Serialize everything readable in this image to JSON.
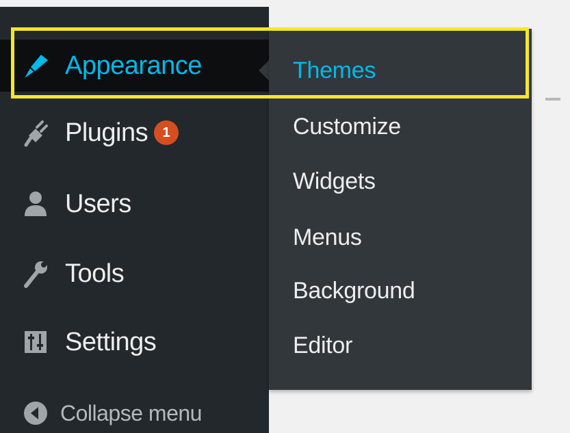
{
  "sidebar": {
    "items": [
      {
        "label": "Appearance",
        "icon": "paintbrush-icon",
        "active": true
      },
      {
        "label": "Plugins",
        "icon": "plugin-icon",
        "badge": "1"
      },
      {
        "label": "Users",
        "icon": "user-icon"
      },
      {
        "label": "Tools",
        "icon": "wrench-icon"
      },
      {
        "label": "Settings",
        "icon": "settings-sliders-icon"
      }
    ],
    "collapse": {
      "label": "Collapse menu",
      "icon": "collapse-arrow-icon"
    }
  },
  "submenu": {
    "items": [
      {
        "label": "Themes",
        "current": true
      },
      {
        "label": "Customize"
      },
      {
        "label": "Widgets"
      },
      {
        "label": "Menus"
      },
      {
        "label": "Background"
      },
      {
        "label": "Editor"
      }
    ]
  },
  "colors": {
    "sidebar_bg": "#23282d",
    "active_bg": "#0c0e10",
    "submenu_bg": "#32373c",
    "accent": "#00b9eb",
    "badge": "#d54e21",
    "highlight": "#f5e62a"
  }
}
